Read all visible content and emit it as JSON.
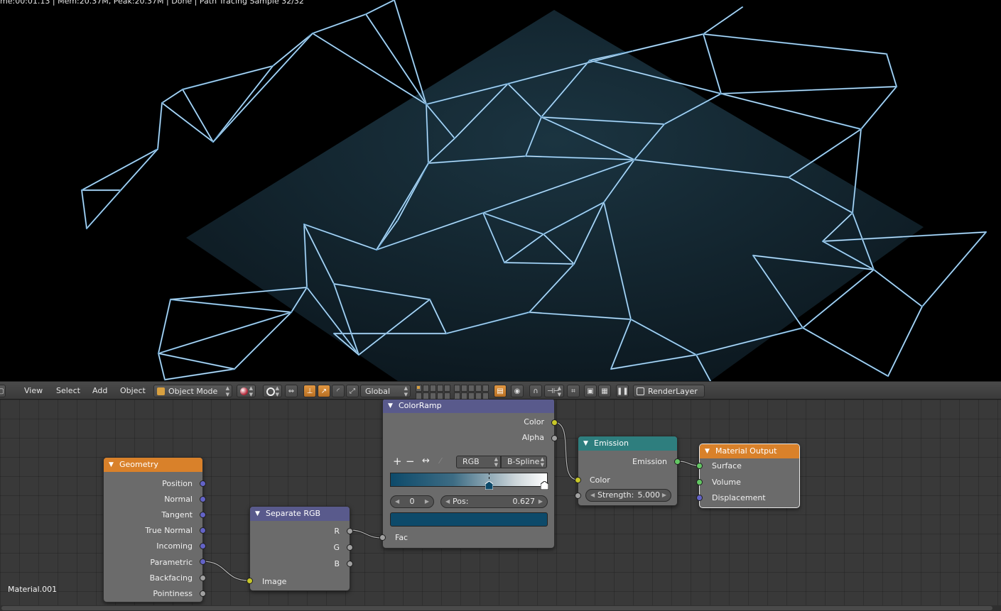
{
  "viewport": {
    "status_text": "me:00:01.13 | Mem:20.37M, Peak:20.37M | Done | Path Tracing Sample 32/32"
  },
  "header": {
    "menus": [
      "View",
      "Select",
      "Add",
      "Object"
    ],
    "mode": "Object Mode",
    "orientation": "Global",
    "layer": "RenderLayer"
  },
  "nodes": {
    "geometry": {
      "title": "Geometry",
      "outputs": [
        "Position",
        "Normal",
        "Tangent",
        "True Normal",
        "Incoming",
        "Parametric",
        "Backfacing",
        "Pointiness"
      ]
    },
    "separate_rgb": {
      "title": "Separate RGB",
      "outputs": [
        "R",
        "G",
        "B"
      ],
      "input": "Image"
    },
    "color_ramp": {
      "title": "ColorRamp",
      "outputs": [
        "Color",
        "Alpha"
      ],
      "color_mode": "RGB",
      "interpolation": "B-Spline",
      "active_index": "0",
      "pos_label": "Pos:",
      "pos_value": "0.627",
      "input": "Fac",
      "active_color": "#0d4a6a",
      "stop_positions": [
        0.627,
        1.0
      ]
    },
    "emission": {
      "title": "Emission",
      "output": "Emission",
      "input_color": "Color",
      "strength_label": "Strength:",
      "strength_value": "5.000"
    },
    "material_output": {
      "title": "Material Output",
      "inputs": [
        "Surface",
        "Volume",
        "Displacement"
      ]
    }
  },
  "material_name": "Material.001",
  "colors": {
    "input_header": "#d9812a",
    "converter_header": "#595a8c",
    "shader_header": "#2e7e7e",
    "output_header": "#d9812a"
  }
}
